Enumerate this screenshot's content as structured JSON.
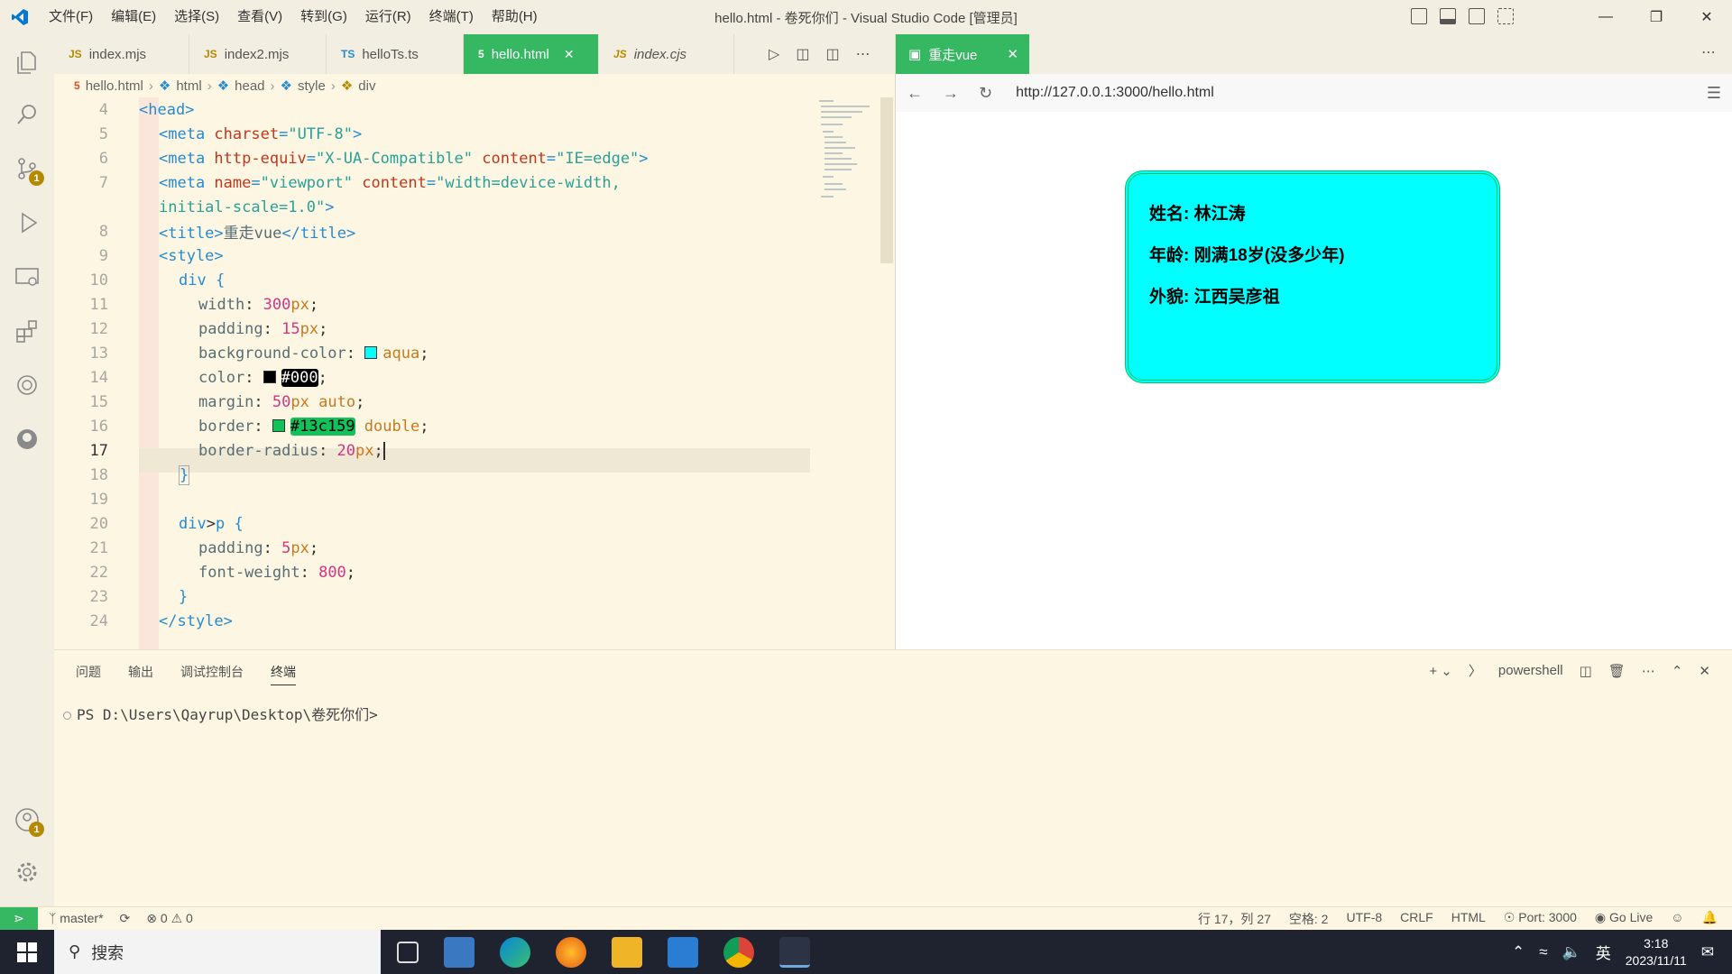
{
  "window": {
    "title": "hello.html - 卷死你们 - Visual Studio Code [管理员]",
    "menus": [
      "文件(F)",
      "编辑(E)",
      "选择(S)",
      "查看(V)",
      "转到(G)",
      "运行(R)",
      "终端(T)",
      "帮助(H)"
    ]
  },
  "tabs": [
    {
      "type": "JS",
      "label": "index.mjs"
    },
    {
      "type": "JS",
      "label": "index2.mjs"
    },
    {
      "type": "TS",
      "label": "helloTs.ts"
    },
    {
      "type": "5",
      "label": "hello.html"
    },
    {
      "type": "JS",
      "label": "index.cjs"
    }
  ],
  "breadcrumb": [
    "hello.html",
    "html",
    "head",
    "style",
    "div"
  ],
  "editor": {
    "line_numbers": [
      "4",
      "5",
      "6",
      "7",
      "",
      "8",
      "9",
      "10",
      "11",
      "12",
      "13",
      "14",
      "15",
      "16",
      "17",
      "18",
      "19",
      "20",
      "21",
      "22",
      "23",
      "24"
    ],
    "current_line": "17",
    "l4": "<head>",
    "l5": [
      "<meta ",
      "charset",
      "=",
      "\"UTF-8\"",
      ">"
    ],
    "l6": [
      "<meta ",
      "http-equiv",
      "=",
      "\"X-UA-Compatible\"",
      " content",
      "=",
      "\"IE=edge\"",
      ">"
    ],
    "l7a": [
      "<meta ",
      "name",
      "=",
      "\"viewport\"",
      " content",
      "=",
      "\"width=device-width,"
    ],
    "l7b": [
      "initial-scale=1.0\"",
      ">"
    ],
    "l8": [
      "<title>",
      "重走vue",
      "</title>"
    ],
    "l9": "<style>",
    "l10": [
      "div ",
      "{"
    ],
    "l11": [
      "width",
      ": ",
      "300",
      "px",
      ";"
    ],
    "l12": [
      "padding",
      ": ",
      "15",
      "px",
      ";"
    ],
    "l13": [
      "background-color",
      ": ",
      "aqua",
      ";"
    ],
    "l14": [
      "color",
      ": ",
      "#000",
      ";"
    ],
    "l15": [
      "margin",
      ": ",
      "50",
      "px",
      " auto",
      ";"
    ],
    "l16": [
      "border",
      ": ",
      "#13c159",
      " double",
      ";"
    ],
    "l17": [
      "border-radius",
      ": ",
      "20",
      "px",
      ";"
    ],
    "l18": "}",
    "l20": [
      "div",
      ">",
      "p",
      " {"
    ],
    "l21": [
      "padding",
      ": ",
      "5",
      "px",
      ";"
    ],
    "l22": [
      "font-weight",
      ": ",
      "800",
      ";"
    ],
    "l23": "}",
    "l24": "</style>"
  },
  "preview": {
    "tab_label": "重走vue",
    "url": "http://127.0.0.1:3000/hello.html",
    "paragraphs": [
      "姓名: 林江涛",
      "年龄: 刚满18岁(没多少年)",
      "外貌: 江西吴彦祖"
    ]
  },
  "panel": {
    "tabs": [
      "问题",
      "输出",
      "调试控制台",
      "终端"
    ],
    "shell": "powershell",
    "prompt": "PS D:\\Users\\Qayrup\\Desktop\\卷死你们>"
  },
  "status": {
    "branch": "master*",
    "errors": "0",
    "warnings": "0",
    "position": "行 17，列 27",
    "spaces": "空格: 2",
    "encoding": "UTF-8",
    "eol": "CRLF",
    "language": "HTML",
    "port": "Port: 3000",
    "golive": "Go Live"
  },
  "taskbar": {
    "search": "搜索",
    "ime": "英",
    "time": "3:18",
    "date": "2023/11/11"
  },
  "colors": {
    "accent": "#36b862",
    "aqua": "#00ffff",
    "border": "#13c159"
  },
  "icons": {
    "activity": [
      "files-icon",
      "search-icon",
      "source-control-icon",
      "run-debug-icon",
      "remote-explorer-icon",
      "extensions-icon",
      "chatgpt-icon",
      "github-icon",
      "account-icon",
      "settings-gear-icon"
    ]
  }
}
